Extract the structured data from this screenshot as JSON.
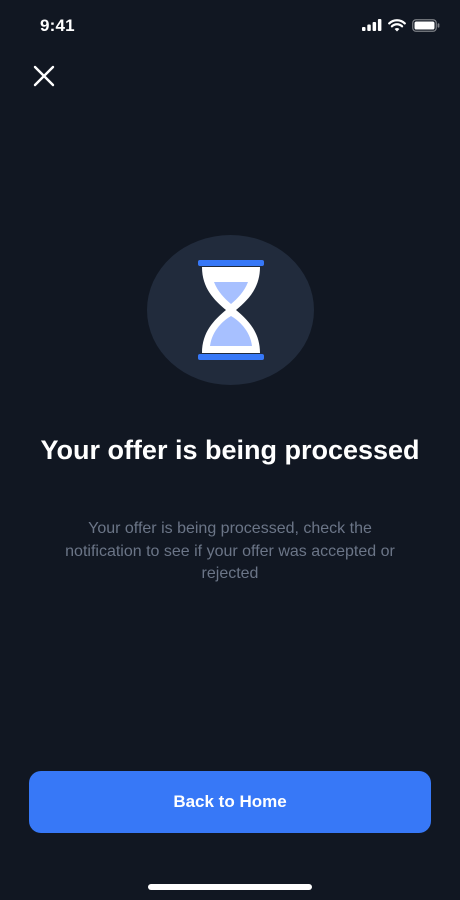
{
  "status_bar": {
    "time": "9:41",
    "icons": [
      "cellular-signal-icon",
      "wifi-icon",
      "battery-icon"
    ]
  },
  "close_icon": "close-icon",
  "hero": {
    "icon": "hourglass-icon",
    "circle_color": "#212b3c",
    "accent_color": "#3778f7",
    "sand_color": "#a7c0ff"
  },
  "title": "Your offer is being processed",
  "description": "Your offer is being processed, check the notification to see if your offer was accepted or rejected",
  "primary_button": {
    "label": "Back to Home",
    "color": "#3778f7"
  },
  "colors": {
    "background": "#111722",
    "text_primary": "#ffffff",
    "text_secondary": "#6b7587"
  }
}
